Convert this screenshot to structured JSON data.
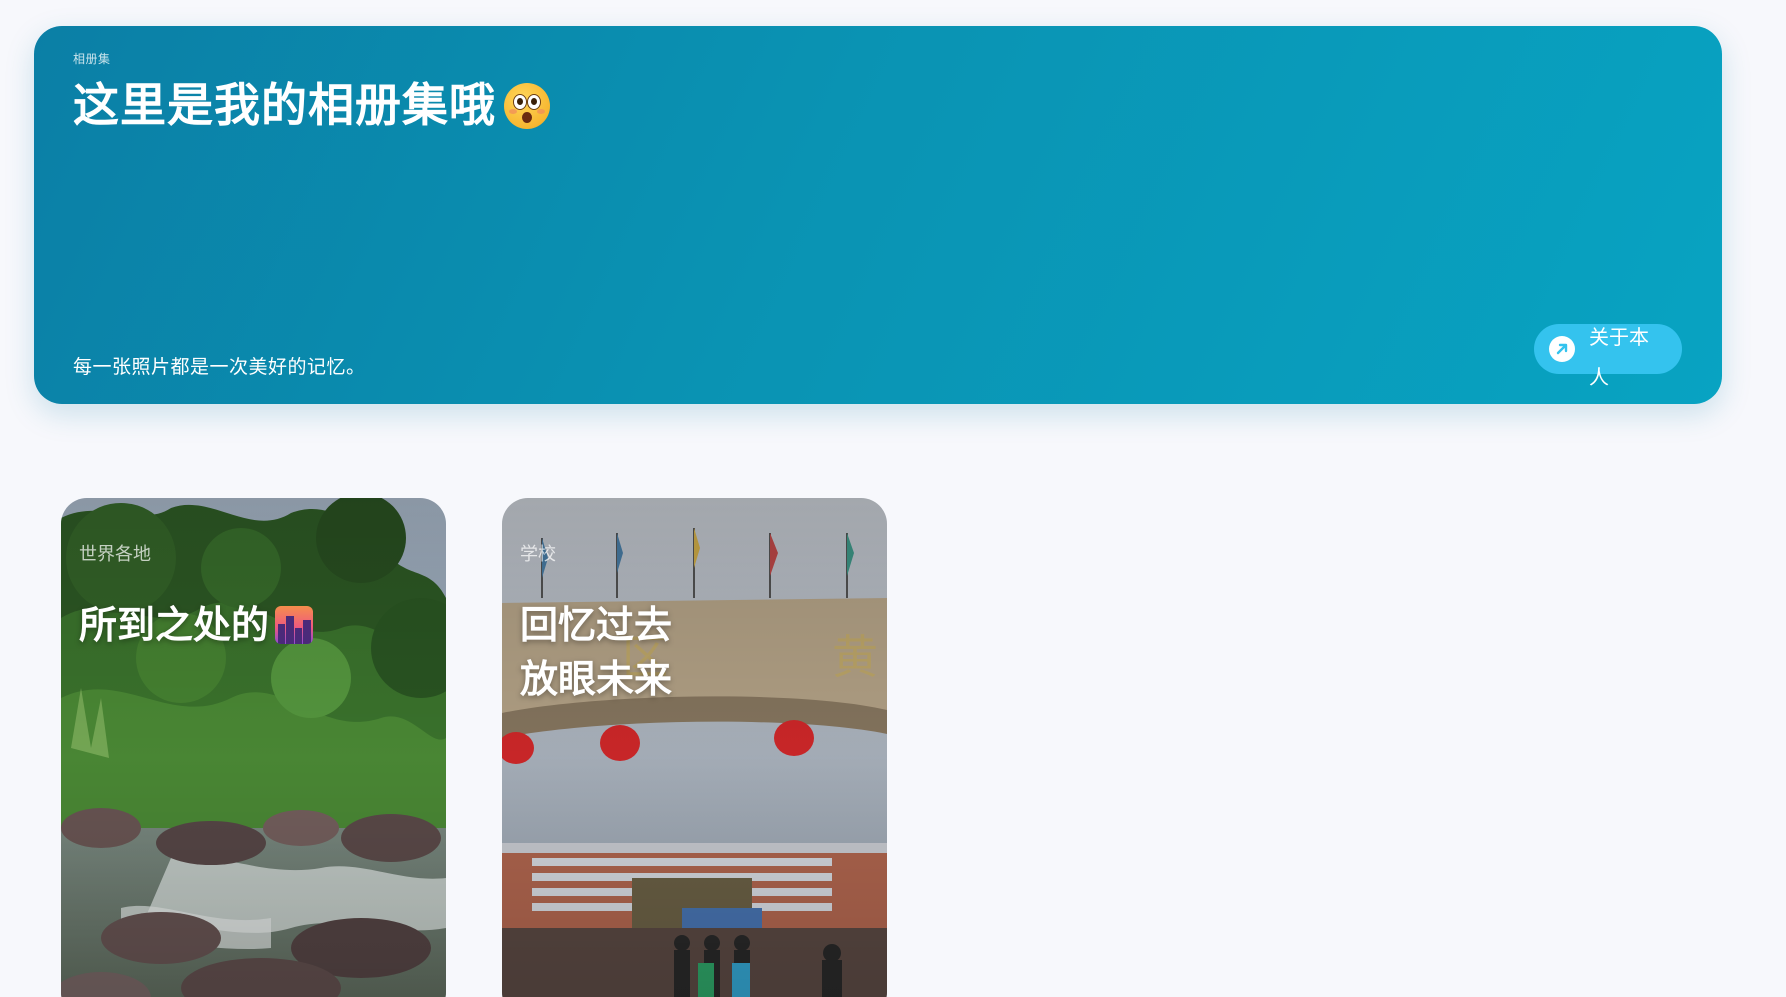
{
  "hero": {
    "kicker": "相册集",
    "title": "这里是我的相册集哦",
    "subtitle": "每一张照片都是一次美好的记忆。",
    "about_button_label": "关于本人",
    "title_emoji_icon": "astonished-face-icon",
    "about_button_icon": "arrow-up-right-icon",
    "colors": {
      "gradient_start": "#0b7fa6",
      "gradient_end": "#08a3c2",
      "button_bg": "#34c3ee"
    }
  },
  "albums": [
    {
      "category": "世界各地",
      "title": "所到之处的",
      "title_emoji_icon": "cityscape-at-dusk-icon",
      "photo": "mountain-stream-photo"
    },
    {
      "category": "学校",
      "title_line1": "回忆过去",
      "title_line2": "放眼未来",
      "photo": "school-gate-photo"
    }
  ]
}
